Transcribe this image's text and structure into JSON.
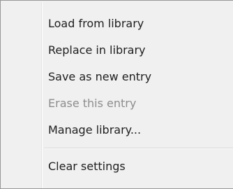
{
  "context_menu": {
    "items": [
      {
        "label": "Load from library",
        "enabled": true
      },
      {
        "label": "Replace in library",
        "enabled": true
      },
      {
        "label": "Save as new entry",
        "enabled": true
      },
      {
        "label": "Erase this entry",
        "enabled": false
      },
      {
        "label": "Manage library...",
        "enabled": true
      }
    ],
    "footer_items": [
      {
        "label": "Clear settings",
        "enabled": true
      }
    ]
  }
}
